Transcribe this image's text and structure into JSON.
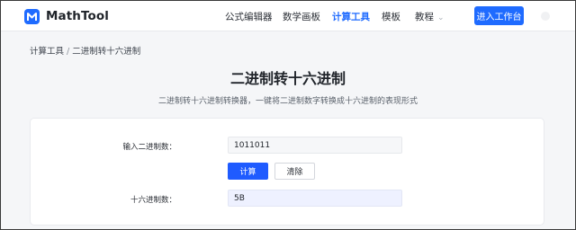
{
  "brand": {
    "name": "MathTool",
    "accent": "#1f6bff",
    "logo_icon": "m-logo-icon"
  },
  "nav": {
    "items": [
      {
        "label": "公式编辑器",
        "active": false
      },
      {
        "label": "数学画板",
        "active": false
      },
      {
        "label": "计算工具",
        "active": true
      },
      {
        "label": "模板",
        "active": false
      },
      {
        "label": "教程",
        "active": false,
        "dropdown": true
      }
    ],
    "dropdown_icon": "chevron-down-icon",
    "cta_label": "进入工作台"
  },
  "breadcrumb": {
    "parent": "计算工具",
    "separator": "/",
    "current": "二进制转十六进制"
  },
  "page": {
    "title": "二进制转十六进制",
    "subtitle": "二进制转十六进制转换器，一键将二进制数字转换成十六进制的表现形式"
  },
  "converter": {
    "input_label": "输入二进制数：",
    "input_value": "1011011",
    "calculate_label": "计算",
    "clear_label": "清除",
    "output_label": "十六进制数：",
    "output_value": "5B"
  }
}
